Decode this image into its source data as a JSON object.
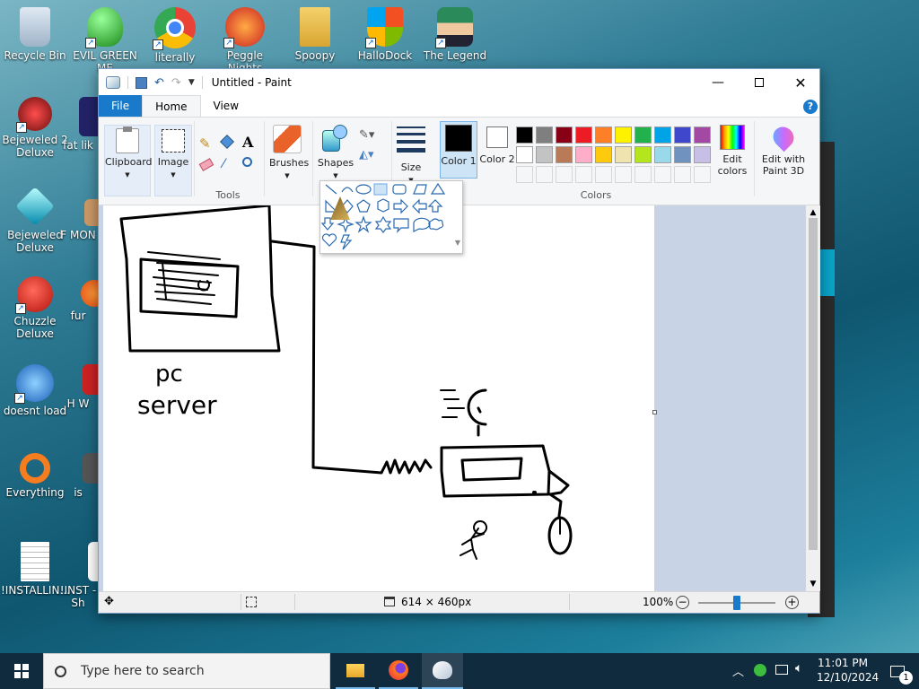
{
  "desktop": {
    "icons": [
      {
        "label": "Recycle Bin"
      },
      {
        "label": "EVIL GREEN ME"
      },
      {
        "label": "literally"
      },
      {
        "label": "Peggle Nights"
      },
      {
        "label": "Spoopy"
      },
      {
        "label": "HalloDock"
      },
      {
        "label": "The Legend"
      },
      {
        "label": "Bejeweled 2 Deluxe"
      },
      {
        "label": "fat lik"
      },
      {
        "label": "Bejeweled Deluxe"
      },
      {
        "label": "F MON"
      },
      {
        "label": "Chuzzle Deluxe"
      },
      {
        "label": "fur"
      },
      {
        "label": "doesnt load"
      },
      {
        "label": "H W"
      },
      {
        "label": "Everything"
      },
      {
        "label": "is"
      },
      {
        "label": "!INSTALLIN..."
      },
      {
        "label": "!INST - Sh"
      }
    ]
  },
  "window": {
    "title": "Untitled - Paint",
    "tabs": {
      "file": "File",
      "home": "Home",
      "view": "View"
    },
    "ribbon": {
      "clipboard": "Clipboard",
      "image": "Image",
      "tools": "Tools",
      "brushes": "Brushes",
      "shapes": "Shapes",
      "size": "Size",
      "color1": "Color 1",
      "color2": "Color 2",
      "colors": "Colors",
      "edit_colors": "Edit colors",
      "edit_paint3d": "Edit with Paint 3D",
      "color1_value": "#000000",
      "color2_value": "#ffffff",
      "palette_row1": [
        "#000000",
        "#7f7f7f",
        "#880015",
        "#ed1c24",
        "#ff7f27",
        "#fff200",
        "#22b14c",
        "#00a2e8",
        "#3f48cc",
        "#a349a4"
      ],
      "palette_row2": [
        "#ffffff",
        "#c3c3c3",
        "#b97a57",
        "#ffaec9",
        "#ffc90e",
        "#efe4b0",
        "#b5e61d",
        "#99d9ea",
        "#7092be",
        "#c8bfe7"
      ]
    },
    "drawing": {
      "label_line1": "pc",
      "label_line2": "server"
    },
    "status": {
      "canvas_size": "614 × 460px",
      "zoom": "100%",
      "zoom_fraction": 0.5
    }
  },
  "taskbar": {
    "search_placeholder": "Type here to search",
    "time": "11:01 PM",
    "date": "12/10/2024",
    "notification_count": "1"
  }
}
